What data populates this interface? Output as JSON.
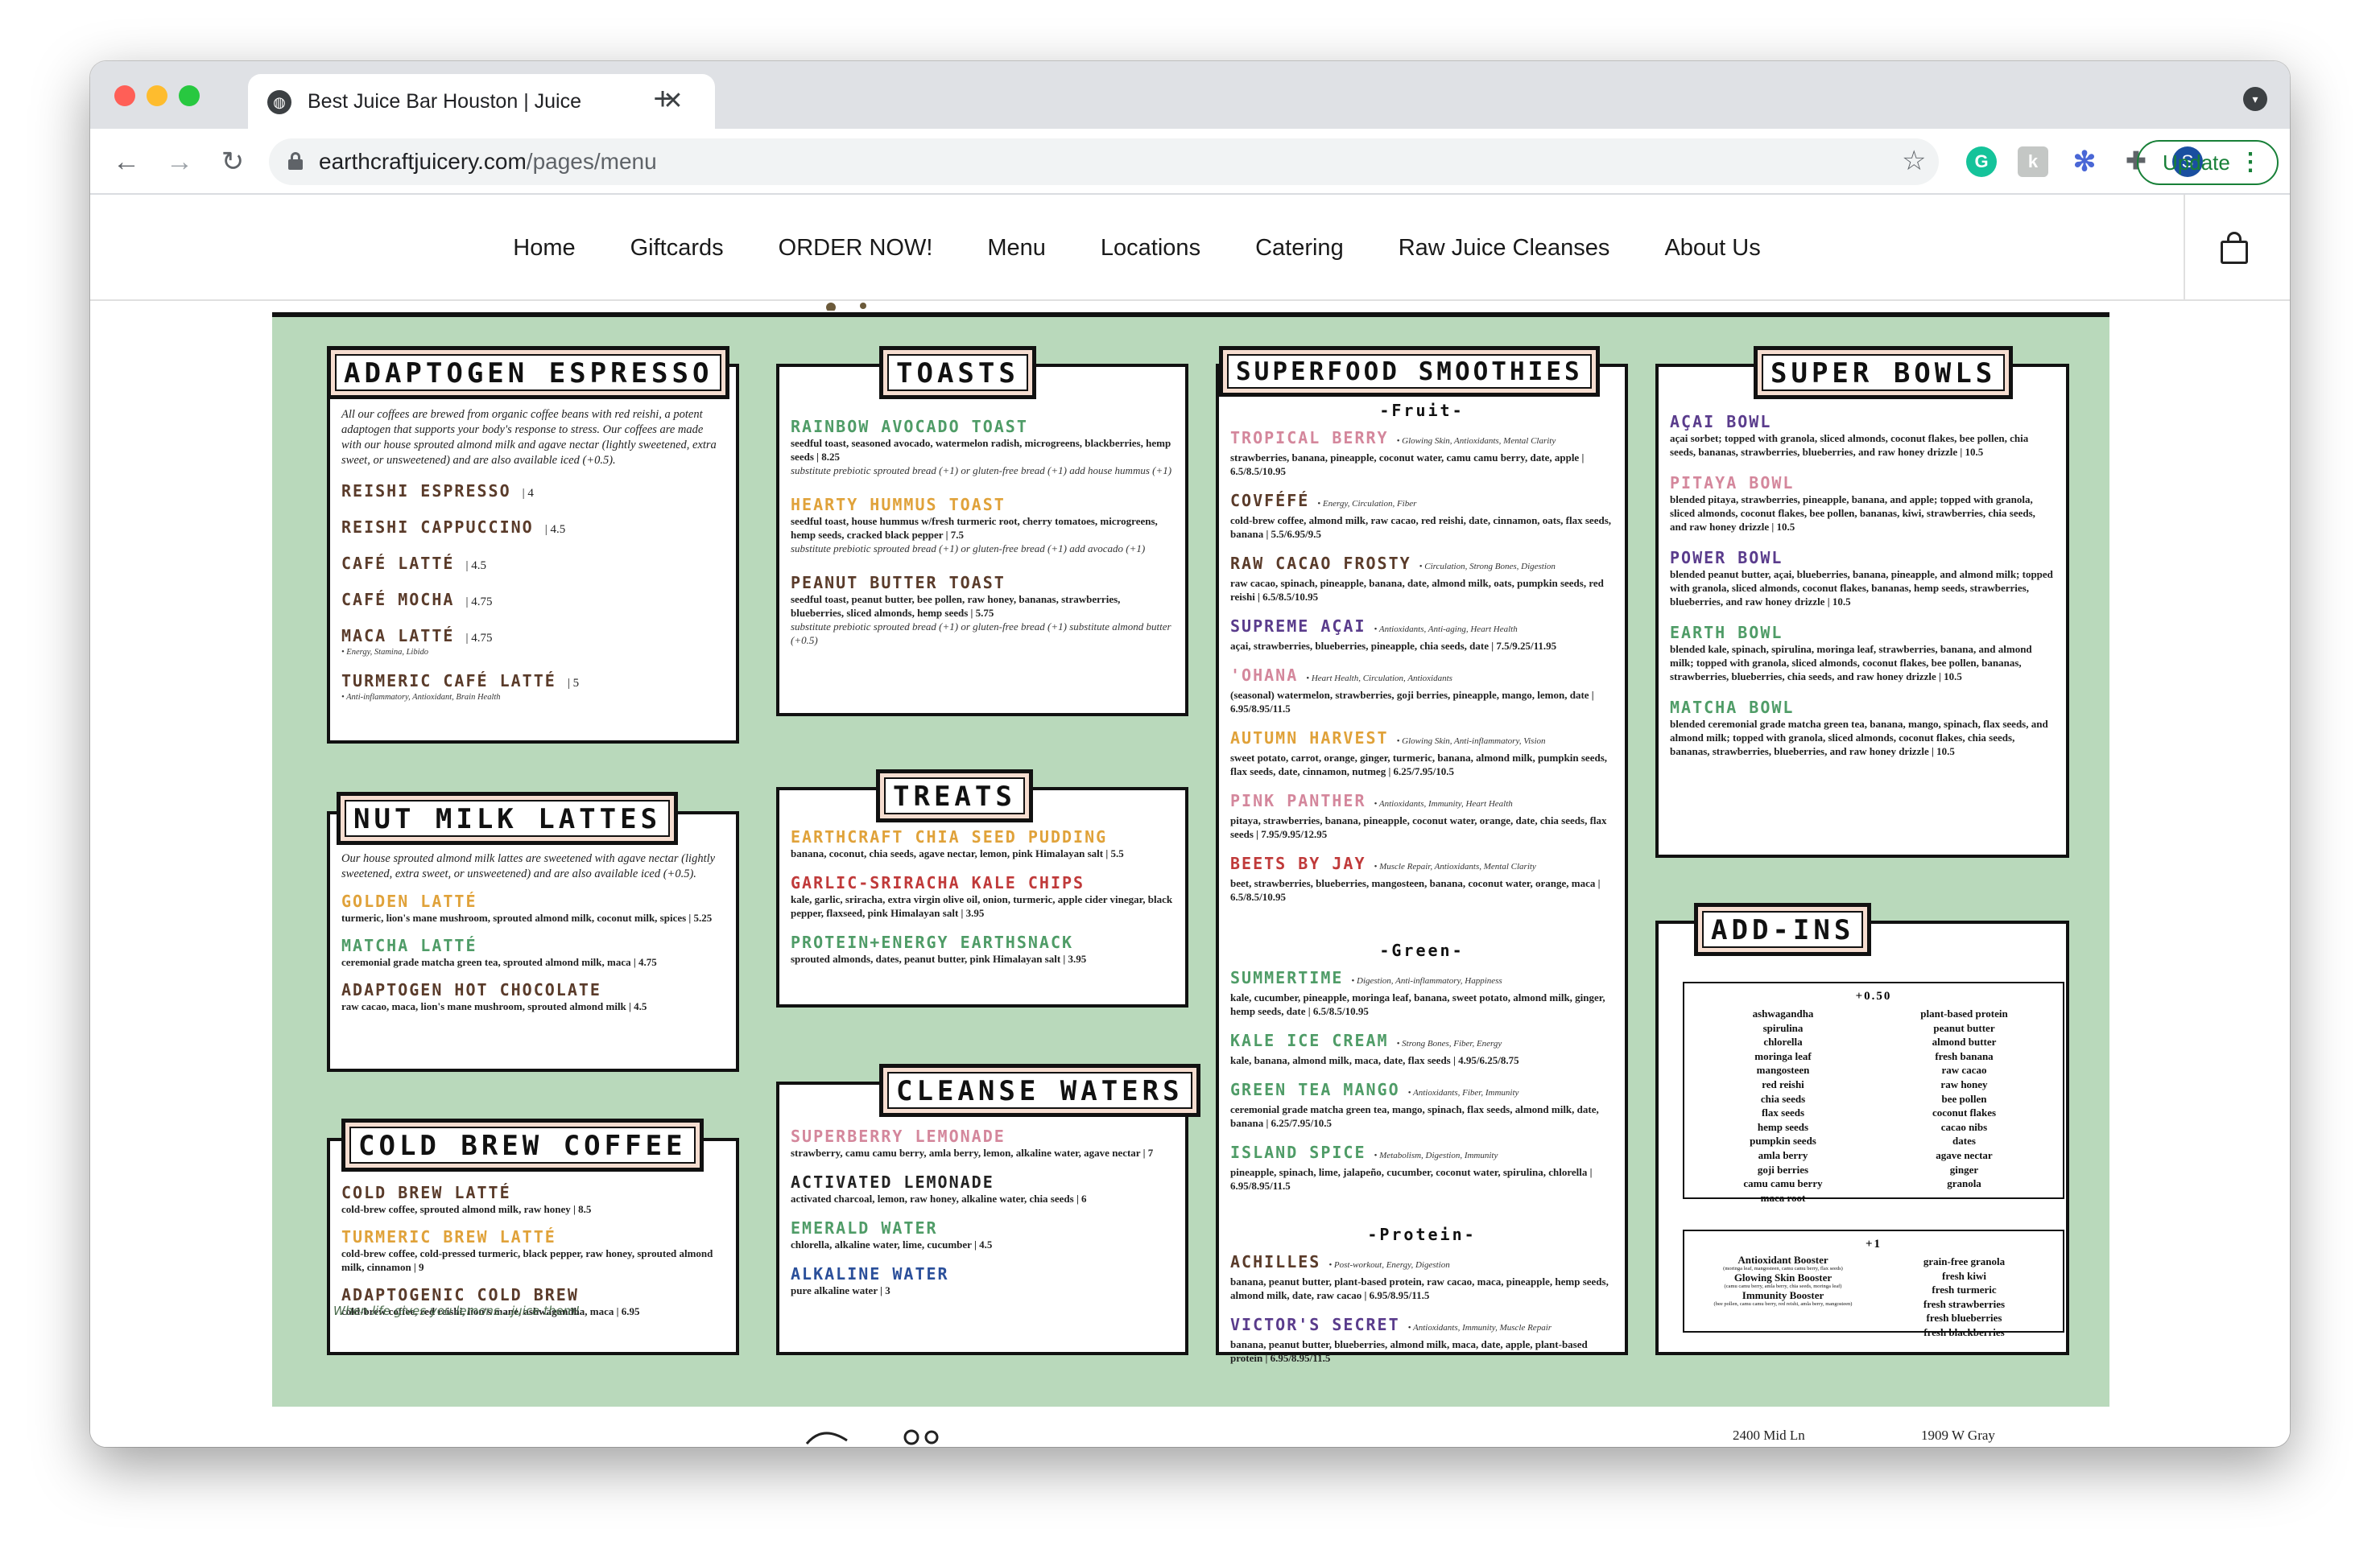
{
  "browser": {
    "tab_title": "Best Juice Bar Houston | Juice",
    "url_domain": "earthcraftjuicery.com",
    "url_path": "/pages/menu",
    "update_label": "Update",
    "profile_initial": "S",
    "ext_grammarly": "G",
    "ext_k": "k",
    "colors": {
      "close": "#ff5f57",
      "minimize": "#febc2e",
      "maximize": "#28c840",
      "update": "#188038"
    }
  },
  "nav": {
    "items": [
      "Home",
      "Giftcards",
      "ORDER NOW!",
      "Menu",
      "Locations",
      "Catering",
      "Raw Juice Cleanses",
      "About Us"
    ]
  },
  "menu": {
    "colors": {
      "board": "#b9d9bb",
      "title_fill": "#f6ddd0"
    },
    "adaptogen": {
      "title": "ADAPTOGEN ESPRESSO",
      "intro": "All our coffees are brewed from organic coffee beans with red reishi, a potent adaptogen that supports your body's response to stress. Our coffees are made with our house sprouted almond milk and agave nectar (lightly sweetened, extra sweet, or unsweetened) and are also available iced (+0.5).",
      "items": [
        {
          "name": "REISHI ESPRESSO",
          "price": "| 4",
          "benefit": ""
        },
        {
          "name": "REISHI CAPPUCCINO",
          "price": "| 4.5",
          "benefit": ""
        },
        {
          "name": "CAFÉ LATTÉ",
          "price": "| 4.5",
          "benefit": ""
        },
        {
          "name": "CAFÉ MOCHA",
          "price": "| 4.75",
          "benefit": ""
        },
        {
          "name": "MACA LATTÉ",
          "price": "| 4.75",
          "benefit": "• Energy, Stamina, Libido"
        },
        {
          "name": "TURMERIC CAFÉ LATTÉ",
          "price": "| 5",
          "benefit": "• Anti-inflammatory, Antioxidant, Brain Health"
        }
      ]
    },
    "nutmilk": {
      "title": "NUT MILK LATTES",
      "intro": "Our house sprouted almond milk lattes are sweetened with agave nectar (lightly sweetened, extra sweet, or unsweetened) and are also available iced (+0.5).",
      "items": [
        {
          "name": "GOLDEN LATTÉ",
          "desc": "turmeric, lion's mane mushroom, sprouted almond milk, coconut milk, spices | 5.25"
        },
        {
          "name": "MATCHA LATTÉ",
          "desc": "ceremonial grade matcha green tea, sprouted almond milk, maca | 4.75"
        },
        {
          "name": "ADAPTOGEN HOT CHOCOLATE",
          "desc": "raw cacao, maca, lion's mane mushroom, sprouted almond milk | 4.5"
        }
      ]
    },
    "coldbrew": {
      "title": "COLD BREW COFFEE",
      "items": [
        {
          "name": "COLD BREW LATTÉ",
          "desc": "cold-brew coffee, sprouted almond milk, raw honey | 8.5"
        },
        {
          "name": "TURMERIC BREW LATTÉ",
          "desc": "cold-brew coffee, cold-pressed turmeric, black pepper, raw honey, sprouted almond milk, cinnamon | 9"
        },
        {
          "name": "ADAPTOGENIC COLD BREW",
          "desc": "cold-brew coffee, red reishi, lion's mane, ashwagandha, maca | 6.95"
        }
      ]
    },
    "toasts": {
      "title": "TOASTS",
      "items": [
        {
          "name": "RAINBOW AVOCADO TOAST",
          "desc": "seedful toast, seasoned avocado, watermelon radish, microgreens, blackberries, hemp seeds | 8.25",
          "note": "substitute prebiotic sprouted bread (+1) or gluten-free bread (+1) add house hummus (+1)"
        },
        {
          "name": "HEARTY HUMMUS TOAST",
          "desc": "seedful toast, house hummus w/fresh turmeric root, cherry tomatoes, microgreens, hemp seeds, cracked black pepper | 7.5",
          "note": "substitute prebiotic sprouted bread (+1) or gluten-free bread (+1) add avocado (+1)"
        },
        {
          "name": "PEANUT BUTTER TOAST",
          "desc": "seedful toast, peanut butter, bee pollen, raw honey, bananas, strawberries, blueberries, sliced almonds, hemp seeds | 5.75",
          "note": "substitute prebiotic sprouted bread (+1) or gluten-free bread (+1) substitute almond butter (+0.5)"
        }
      ]
    },
    "treats": {
      "title": "TREATS",
      "items": [
        {
          "name": "EARTHCRAFT CHIA SEED PUDDING",
          "desc": "banana, coconut, chia seeds, agave nectar, lemon, pink Himalayan salt | 5.5"
        },
        {
          "name": "GARLIC-SRIRACHA KALE CHIPS",
          "desc": "kale, garlic, sriracha, extra virgin olive oil, onion, turmeric, apple cider vinegar, black pepper, flaxseed, pink Himalayan salt | 3.95"
        },
        {
          "name": "PROTEIN+ENERGY EARTHSNACK",
          "desc": "sprouted almonds, dates, peanut butter, pink Himalayan salt | 3.95"
        }
      ]
    },
    "cleanse": {
      "title": "CLEANSE WATERS",
      "items": [
        {
          "name": "SUPERBERRY LEMONADE",
          "desc": "strawberry, camu camu berry, amla berry, lemon, alkaline water, agave nectar | 7"
        },
        {
          "name": "ACTIVATED LEMONADE",
          "desc": "activated charcoal, lemon, raw honey, alkaline water, chia seeds | 6"
        },
        {
          "name": "EMERALD WATER",
          "desc": "chlorella, alkaline water, lime, cucumber | 4.5"
        },
        {
          "name": "ALKALINE WATER",
          "desc": "pure alkaline water | 3"
        }
      ]
    },
    "smoothies": {
      "title": "SUPERFOOD SMOOTHIES",
      "fruit_label": "-Fruit-",
      "green_label": "-Green-",
      "protein_label": "-Protein-",
      "fruit": [
        {
          "name": "TROPICAL BERRY",
          "tag": "• Glowing Skin, Antioxidants, Mental Clarity",
          "desc": "strawberries, banana, pineapple, coconut water, camu camu berry, date, apple | 6.5/8.5/10.95"
        },
        {
          "name": "COVFÉFÉ",
          "tag": "• Energy, Circulation, Fiber",
          "desc": "cold-brew coffee, almond milk, raw cacao, red reishi, date, cinnamon, oats, flax seeds, banana | 5.5/6.95/9.5"
        },
        {
          "name": "RAW CACAO FROSTY",
          "tag": "• Circulation, Strong Bones, Digestion",
          "desc": "raw cacao, spinach, pineapple, banana, date, almond milk, oats, pumpkin seeds, red reishi | 6.5/8.5/10.95"
        },
        {
          "name": "SUPREME AÇAI",
          "tag": "• Antioxidants, Anti-aging, Heart Health",
          "desc": "açai, strawberries, blueberries, pineapple, chia seeds, date | 7.5/9.25/11.95"
        },
        {
          "name": "'OHANA",
          "tag": "• Heart Health, Circulation, Antioxidants",
          "desc": "(seasonal) watermelon, strawberries, goji berries, pineapple, mango, lemon, date | 6.95/8.95/11.5"
        },
        {
          "name": "AUTUMN HARVEST",
          "tag": "• Glowing Skin, Anti-inflammatory, Vision",
          "desc": "sweet potato, carrot, orange, ginger, turmeric, banana, almond milk, pumpkin seeds, flax seeds, date, cinnamon, nutmeg | 6.25/7.95/10.5"
        },
        {
          "name": "PINK PANTHER",
          "tag": "• Antioxidants, Immunity, Heart Health",
          "desc": "pitaya, strawberries, banana, pineapple, coconut water, orange, date, chia seeds, flax seeds | 7.95/9.95/12.95"
        },
        {
          "name": "BEETS BY JAY",
          "tag": "• Muscle Repair, Antioxidants, Mental Clarity",
          "desc": "beet, strawberries, blueberries, mangosteen, banana, coconut water, orange, maca | 6.5/8.5/10.95"
        }
      ],
      "green": [
        {
          "name": "SUMMERTIME",
          "tag": "• Digestion, Anti-inflammatory, Happiness",
          "desc": "kale, cucumber, pineapple, moringa leaf, banana, sweet potato, almond milk, ginger, hemp seeds, date | 6.5/8.5/10.95"
        },
        {
          "name": "KALE ICE CREAM",
          "tag": "• Strong Bones, Fiber, Energy",
          "desc": "kale, banana, almond milk, maca, date, flax seeds | 4.95/6.25/8.75"
        },
        {
          "name": "GREEN TEA MANGO",
          "tag": "• Antioxidants, Fiber, Immunity",
          "desc": "ceremonial grade matcha green tea, mango, spinach, flax seeds, almond milk, date, banana | 6.25/7.95/10.5"
        },
        {
          "name": "ISLAND SPICE",
          "tag": "• Metabolism, Digestion, Immunity",
          "desc": "pineapple, spinach, lime, jalapeño, cucumber, coconut water, spirulina, chlorella | 6.95/8.95/11.5"
        }
      ],
      "protein": [
        {
          "name": "ACHILLES",
          "tag": "• Post-workout, Energy, Digestion",
          "desc": "banana, peanut butter, plant-based protein, raw cacao, maca, pineapple, hemp seeds, almond milk, date, raw cacao | 6.95/8.95/11.5"
        },
        {
          "name": "VICTOR'S SECRET",
          "tag": "• Antioxidants, Immunity, Muscle Repair",
          "desc": "banana, peanut butter, blueberries, almond milk, maca, date, apple, plant-based protein | 6.95/8.95/11.5"
        }
      ]
    },
    "bowls": {
      "title": "SUPER BOWLS",
      "items": [
        {
          "name": "AÇAI BOWL",
          "desc": "açai sorbet; topped with granola, sliced almonds, coconut flakes, bee pollen, chia seeds, bananas, strawberries, blueberries, and raw honey drizzle | 10.5"
        },
        {
          "name": "PITAYA BOWL",
          "desc": "blended pitaya, strawberries, pineapple, banana, and apple; topped with granola, sliced almonds, coconut flakes, bee pollen, bananas, kiwi, strawberries, chia seeds, and raw honey drizzle | 10.5"
        },
        {
          "name": "POWER BOWL",
          "desc": "blended peanut butter, açai, blueberries, banana, pineapple, and almond milk; topped with granola, sliced almonds, coconut flakes, bananas, hemp seeds, strawberries, blueberries, and raw honey drizzle | 10.5"
        },
        {
          "name": "EARTH BOWL",
          "desc": "blended kale, spinach, spirulina, moringa leaf, strawberries, banana, and almond milk; topped with granola, sliced almonds, coconut flakes, bee pollen, bananas, strawberries, blueberries, chia seeds, and raw honey drizzle | 10.5"
        },
        {
          "name": "MATCHA BOWL",
          "desc": "blended ceremonial grade matcha green tea, banana, mango, spinach, flax seeds, and almond milk; topped with granola, sliced almonds, coconut flakes, chia seeds, bananas, strawberries, blueberries, and raw honey drizzle | 10.5"
        }
      ]
    },
    "addins": {
      "title": "ADD-INS",
      "tier1_label": "+0.50",
      "tier1_left": [
        "ashwagandha",
        "spirulina",
        "chlorella",
        "moringa leaf",
        "mangosteen",
        "red reishi",
        "chia seeds",
        "flax seeds",
        "hemp seeds",
        "pumpkin seeds",
        "amla berry",
        "goji berries",
        "camu camu berry",
        "maca root"
      ],
      "tier1_right": [
        "plant-based protein",
        "peanut butter",
        "almond butter",
        "fresh banana",
        "raw cacao",
        "raw honey",
        "bee pollen",
        "coconut flakes",
        "cacao nibs",
        "dates",
        "agave nectar",
        "ginger",
        "granola"
      ],
      "tier2_label": "+1",
      "tier2_left": [
        {
          "name": "Antioxidant Booster",
          "sub": "(moringa leaf, mangosteen, camu camu berry, flax seeds)"
        },
        {
          "name": "Glowing Skin Booster",
          "sub": "(camu camu berry, amla berry, chia seeds, moringa leaf)"
        },
        {
          "name": "Immunity Booster",
          "sub": "(bee pollen, camu camu berry, red reishi, amla berry, mangosteen)"
        }
      ],
      "tier2_right": [
        "grain-free granola",
        "fresh kiwi",
        "fresh turmeric",
        "fresh strawberries",
        "fresh blueberries",
        "fresh blackberries"
      ]
    },
    "tagline": "When life gives you lemons...juice them!"
  },
  "footer": {
    "address_1": "2400 Mid Ln",
    "address_2": "1909 W Gray"
  }
}
